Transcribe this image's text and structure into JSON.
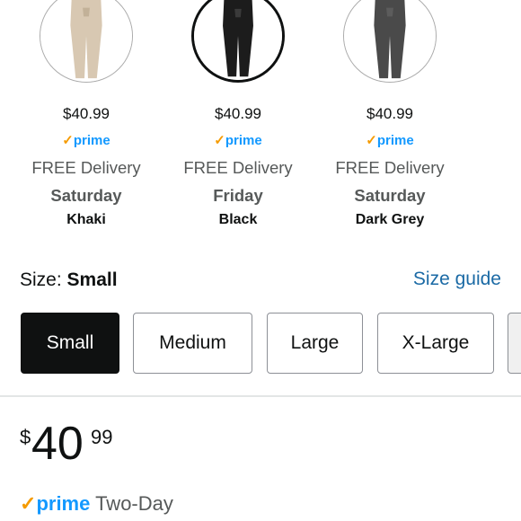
{
  "colors": [
    {
      "price": "$40.99",
      "prime": "prime",
      "delivery": "FREE Delivery",
      "day": "Saturday",
      "name": "Khaki",
      "fill": "#d8c8b2",
      "selected": false
    },
    {
      "price": "$40.99",
      "prime": "prime",
      "delivery": "FREE Delivery",
      "day": "Friday",
      "name": "Black",
      "fill": "#1c1c1c",
      "selected": true
    },
    {
      "price": "$40.99",
      "prime": "prime",
      "delivery": "FREE Delivery",
      "day": "Saturday",
      "name": "Dark Grey",
      "fill": "#4a4a4a",
      "selected": false
    }
  ],
  "size": {
    "label": "Size:",
    "selected": "Small",
    "guide": "Size guide",
    "options": [
      "Small",
      "Medium",
      "Large",
      "X-Large"
    ]
  },
  "price": {
    "symbol": "$",
    "whole": "40",
    "fraction": "99"
  },
  "shipping": {
    "check": "✓",
    "prime": "prime",
    "text": "Two-Day"
  },
  "accent": {
    "prime_blue": "#1399ff",
    "prime_orange": "#f59b00",
    "link": "#1b6aa5"
  }
}
